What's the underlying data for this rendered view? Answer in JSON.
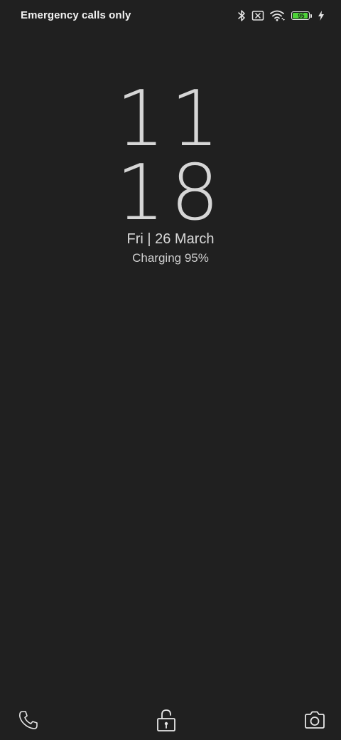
{
  "status_bar": {
    "carrier": "Emergency calls only",
    "icons": [
      "bluetooth-icon",
      "no-sim-icon",
      "wifi-icon",
      "battery-icon",
      "charging-bolt-icon"
    ],
    "battery": {
      "level_percent": 95,
      "label": "95",
      "fill_color": "#4cd137"
    }
  },
  "lockscreen": {
    "clock_hours": "11",
    "clock_minutes": "18",
    "date": "Fri | 26 March",
    "charging": "Charging 95%"
  },
  "bottom_bar": {
    "icons": [
      "phone-icon",
      "unlock-icon",
      "camera-icon"
    ]
  },
  "colors": {
    "background": "#202020",
    "text": "#d6d6d6"
  }
}
